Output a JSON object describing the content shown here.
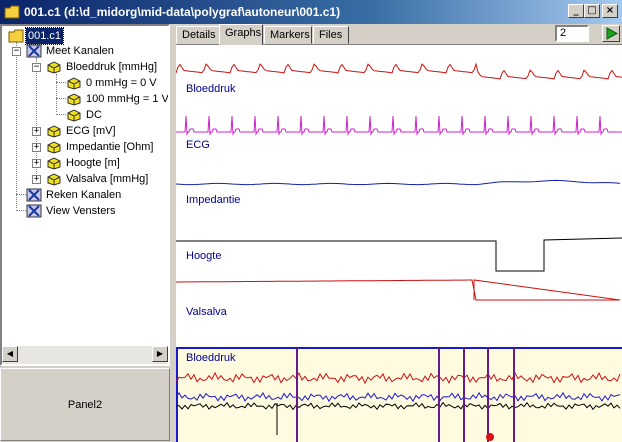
{
  "window": {
    "title": "001.c1  (d:\\d_midorg\\mid-data\\polygraf\\autoneur\\001.c1)",
    "buttons": {
      "minimize": "_",
      "maximize": "□",
      "close": "×"
    }
  },
  "tree": {
    "root": "001.c1",
    "meet_kanalen": "Meet Kanalen",
    "bloeddruk": "Bloeddruk [mmHg]",
    "cal0": "0 mmHg = 0 V",
    "cal100": "100 mmHg = 1 V",
    "dc": "DC",
    "ecg": "ECG [mV]",
    "impedantie": "Impedantie [Ohm]",
    "hoogte": "Hoogte [m]",
    "valsalva": "Valsalva [mmHg]",
    "reken_kanalen": "Reken Kanalen",
    "view_vensters": "View Vensters",
    "expand_symbols": {
      "collapsed": "+",
      "expanded": "−"
    }
  },
  "panel2": {
    "label": "Panel2"
  },
  "tabs": [
    "Details",
    "Graphs",
    "Markers",
    "Files"
  ],
  "active_tab": "Graphs",
  "page_number": "2",
  "scroll_arrows": {
    "left": "◀",
    "right": "▶"
  },
  "traces": {
    "bloeddruk": "Bloeddruk",
    "ecg": "ECG",
    "impedantie": "Impedantie",
    "hoogte": "Hoogte",
    "valsalva": "Valsalva"
  },
  "overview": {
    "label": "Bloeddruk"
  },
  "colors": {
    "titlebar_start": "#0a246a",
    "bloeddruk": "#cc1111",
    "ecg": "#cc22cc",
    "impedantie": "#1122aa",
    "hoogte": "#000000",
    "valsalva": "#cc1111",
    "overview_bg": "#fffbe0",
    "marker": "#6a1a8a",
    "play": "#20a020"
  },
  "icons": {
    "app": "folder-icon",
    "root": "folder-icon",
    "group": "compass-icon",
    "channel": "yellow-cube-icon",
    "play": "play-icon"
  }
}
